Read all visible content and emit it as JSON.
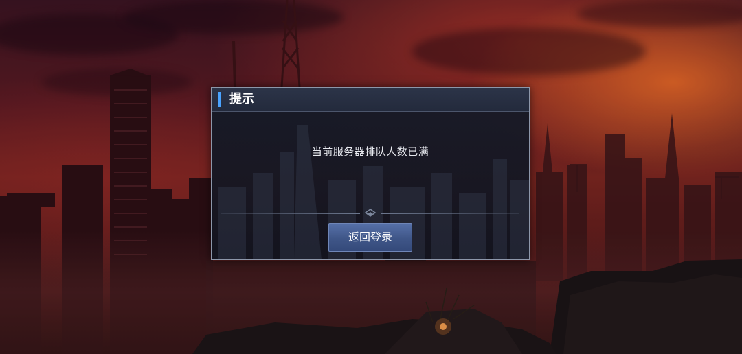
{
  "background": {
    "scene": "ruined-city-sunset"
  },
  "dialog": {
    "title": "提示",
    "message": "当前服务器排队人数已满",
    "return_button_label": "返回登录",
    "accent_color": "#4aa3ff",
    "button_color": "#3f5688"
  }
}
